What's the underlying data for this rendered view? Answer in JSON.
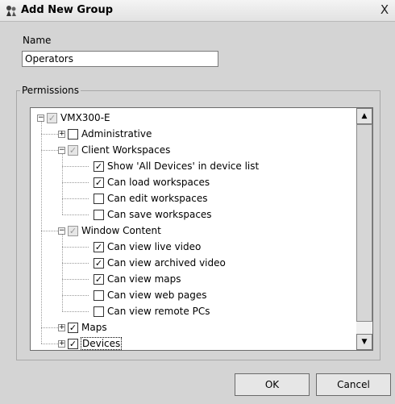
{
  "window": {
    "title": "Add New Group",
    "close_glyph": "X",
    "app_icon": "group-key-icon"
  },
  "name_field": {
    "label": "Name",
    "value": "Operators"
  },
  "permissions": {
    "legend": "Permissions",
    "tree": [
      {
        "label": "VMX300-E",
        "level": 0,
        "expander": "−",
        "check": "grey"
      },
      {
        "label": "Administrative",
        "level": 1,
        "expander": "+",
        "check": "none"
      },
      {
        "label": "Client Workspaces",
        "level": 1,
        "expander": "−",
        "check": "grey"
      },
      {
        "label": "Show 'All Devices' in device list",
        "level": 2,
        "expander": "",
        "check": "checked"
      },
      {
        "label": "Can load workspaces",
        "level": 2,
        "expander": "",
        "check": "checked"
      },
      {
        "label": "Can edit workspaces",
        "level": 2,
        "expander": "",
        "check": "none"
      },
      {
        "label": "Can save workspaces",
        "level": 2,
        "expander": "",
        "check": "none"
      },
      {
        "label": "Window Content",
        "level": 1,
        "expander": "−",
        "check": "grey"
      },
      {
        "label": "Can view live video",
        "level": 2,
        "expander": "",
        "check": "checked"
      },
      {
        "label": "Can view archived video",
        "level": 2,
        "expander": "",
        "check": "checked"
      },
      {
        "label": "Can view maps",
        "level": 2,
        "expander": "",
        "check": "checked"
      },
      {
        "label": "Can view web pages",
        "level": 2,
        "expander": "",
        "check": "none"
      },
      {
        "label": "Can view remote PCs",
        "level": 2,
        "expander": "",
        "check": "none"
      },
      {
        "label": "Maps",
        "level": 1,
        "expander": "+",
        "check": "checked"
      },
      {
        "label": "Devices",
        "level": 1,
        "expander": "+",
        "check": "checked",
        "selected": true
      }
    ]
  },
  "scrollbar": {
    "up_glyph": "▲",
    "down_glyph": "▼"
  },
  "buttons": {
    "ok": "OK",
    "cancel": "Cancel"
  }
}
